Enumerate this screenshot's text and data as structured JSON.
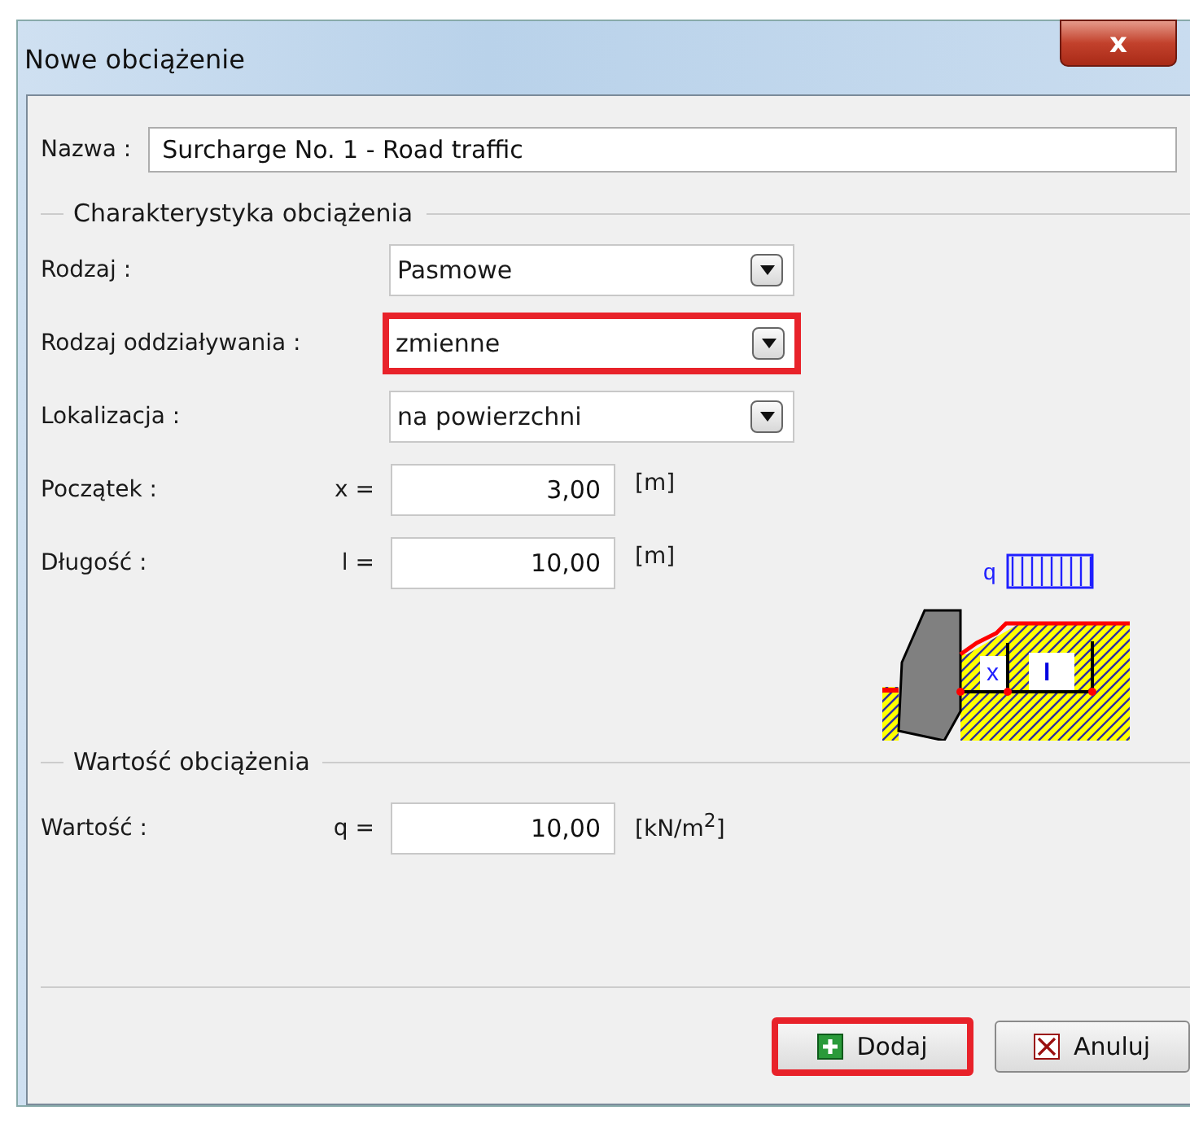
{
  "window": {
    "title": "Nowe obciążenie",
    "close": "x"
  },
  "name_field": {
    "label": "Nazwa :",
    "value": "Surcharge No. 1 - Road traffic"
  },
  "characteristics": {
    "title": "Charakterystyka obciążenia",
    "rows": [
      {
        "kind": "dropdown",
        "label": "Rodzaj :",
        "value": "Pasmowe",
        "highlighted": false
      },
      {
        "kind": "dropdown",
        "label": "Rodzaj oddziaływania :",
        "value": "zmienne",
        "highlighted": true
      },
      {
        "kind": "dropdown",
        "label": "Lokalizacja :",
        "value": "na powierzchni",
        "highlighted": false
      },
      {
        "kind": "number",
        "label": "Początek :",
        "symbol": "x =",
        "value": "3,00",
        "unit": "[m]"
      },
      {
        "kind": "number",
        "label": "Długość :",
        "symbol": "l =",
        "value": "10,00",
        "unit": "[m]"
      }
    ],
    "diagram": {
      "load_label": "q",
      "x_label": "x",
      "l_label": "l"
    }
  },
  "load_value": {
    "title": "Wartość obciążenia",
    "label": "Wartość  :",
    "symbol": "q =",
    "value": "10,00",
    "unit": "[kN/m$^{2}$]"
  },
  "buttons": [
    {
      "kind": "add",
      "label": "Dodaj",
      "highlighted": true
    },
    {
      "kind": "cancel",
      "label": "Anuluj",
      "highlighted": false
    }
  ]
}
